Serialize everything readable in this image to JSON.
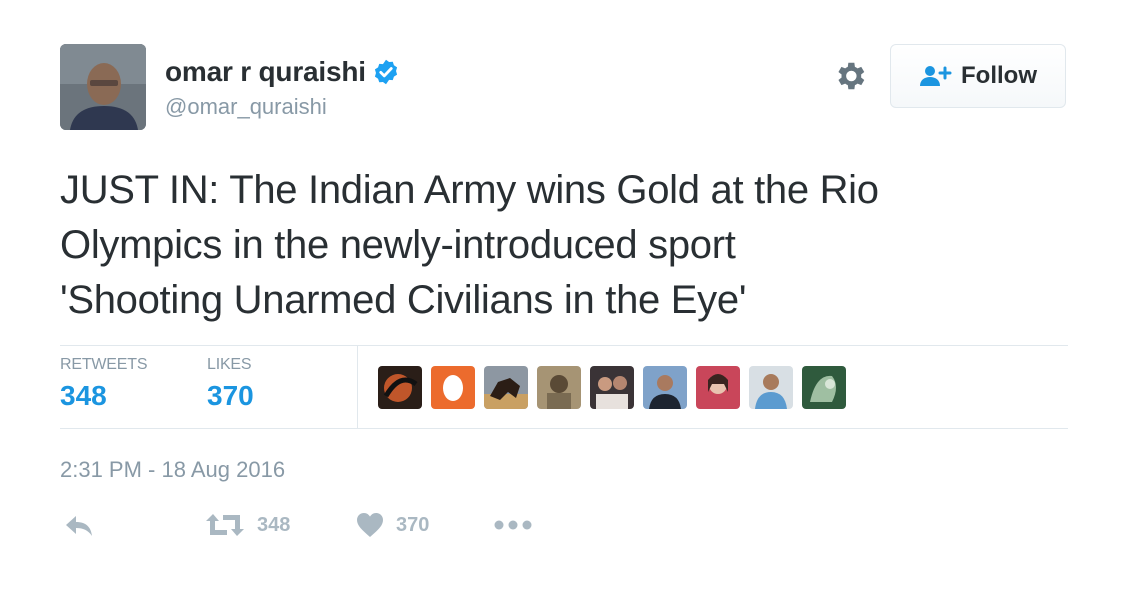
{
  "user": {
    "display_name": "omar r quraishi",
    "handle": "@omar_quraishi",
    "verified": true
  },
  "follow_button": {
    "label": "Follow"
  },
  "tweet": {
    "lines": [
      "JUST IN: The Indian Army wins Gold at the Rio",
      "Olympics in the newly-introduced sport",
      "'Shooting Unarmed Civilians in the Eye'"
    ]
  },
  "stats": {
    "retweets_label": "RETWEETS",
    "retweets_value": "348",
    "likes_label": "LIKES",
    "likes_value": "370"
  },
  "liker_avatars": [
    "liker-avatar-1",
    "liker-avatar-2",
    "liker-avatar-3",
    "liker-avatar-4",
    "liker-avatar-5",
    "liker-avatar-6",
    "liker-avatar-7",
    "liker-avatar-8",
    "liker-avatar-9"
  ],
  "timestamp": "2:31 PM - 18 Aug 2016",
  "actions": {
    "reply_icon": "reply-icon",
    "retweet_icon": "retweet-icon",
    "retweet_count": "348",
    "like_icon": "heart-icon",
    "like_count": "370",
    "more_icon": "more-dots-icon"
  },
  "colors": {
    "link_blue": "#1b95e0",
    "text": "#292f33",
    "muted": "#8899a6",
    "action_gray": "#aab8c2",
    "divider": "#e1e8ed"
  }
}
